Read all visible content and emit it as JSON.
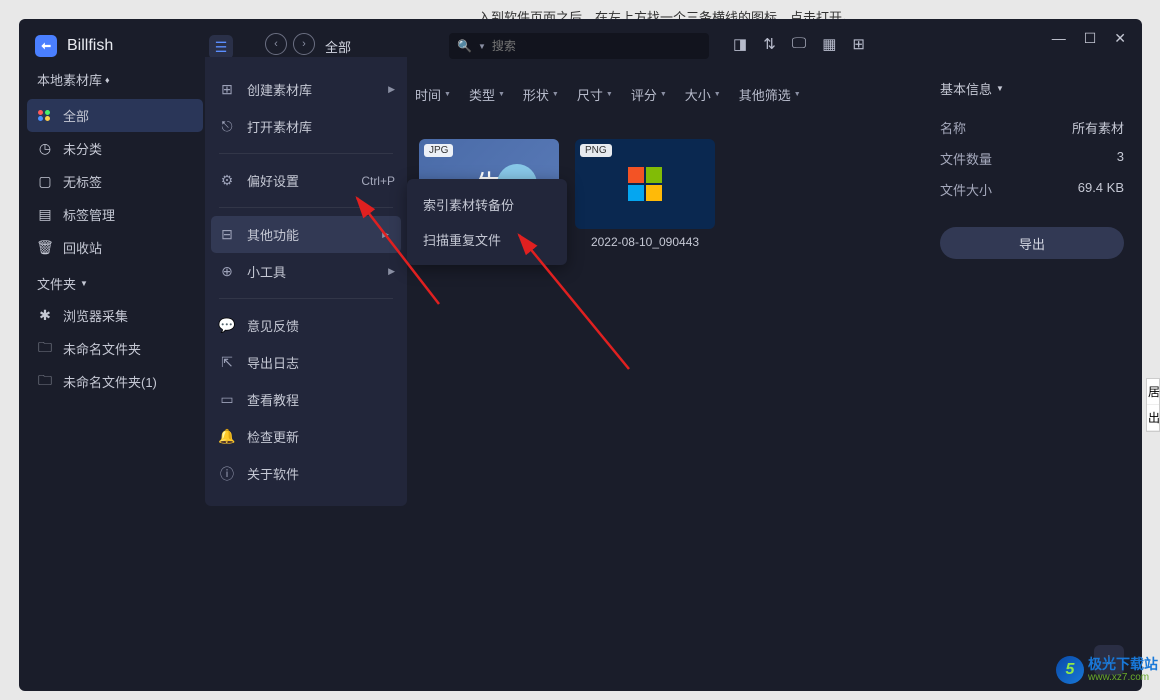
{
  "topText": "入到软件页面之后，在左上方找一个三条横线的图标，点击打开。",
  "app": {
    "name": "Billfish"
  },
  "library": {
    "label": "本地素材库"
  },
  "sidebar": {
    "items": [
      {
        "label": "全部"
      },
      {
        "label": "未分类"
      },
      {
        "label": "无标签"
      },
      {
        "label": "标签管理"
      },
      {
        "label": "回收站"
      }
    ],
    "folderSection": "文件夹",
    "folders": [
      {
        "label": "浏览器采集"
      },
      {
        "label": "未命名文件夹"
      },
      {
        "label": "未命名文件夹(1)"
      }
    ]
  },
  "breadcrumb": "全部",
  "search": {
    "placeholder": "搜索"
  },
  "filters": [
    "时间",
    "类型",
    "形状",
    "尺寸",
    "评分",
    "大小",
    "其他筛选"
  ],
  "mainMenu": {
    "items": [
      {
        "label": "创建素材库",
        "hasSubmenu": true
      },
      {
        "label": "打开素材库"
      },
      {
        "label": "偏好设置",
        "shortcut": "Ctrl+P"
      },
      {
        "label": "其他功能",
        "hasSubmenu": true,
        "highlighted": true
      },
      {
        "label": "小工具",
        "hasSubmenu": true
      },
      {
        "label": "意见反馈"
      },
      {
        "label": "导出日志"
      },
      {
        "label": "查看教程"
      },
      {
        "label": "检查更新"
      },
      {
        "label": "关于软件"
      }
    ]
  },
  "submenu": {
    "items": [
      "索引素材转备份",
      "扫描重复文件"
    ]
  },
  "thumbnails": [
    {
      "badge": "JPG",
      "preview": "生"
    },
    {
      "badge": "PNG",
      "label": "2022-08-10_090443"
    }
  ],
  "infoPanel": {
    "header": "基本信息",
    "rows": [
      {
        "k": "名称",
        "v": "所有素材"
      },
      {
        "k": "文件数量",
        "v": "3"
      },
      {
        "k": "文件大小",
        "v": "69.4 KB"
      }
    ],
    "exportLabel": "导出"
  },
  "watermark": {
    "line1": "极光下载站",
    "line2": "www.xz7.com"
  },
  "rightEdge": [
    "居",
    "出"
  ]
}
